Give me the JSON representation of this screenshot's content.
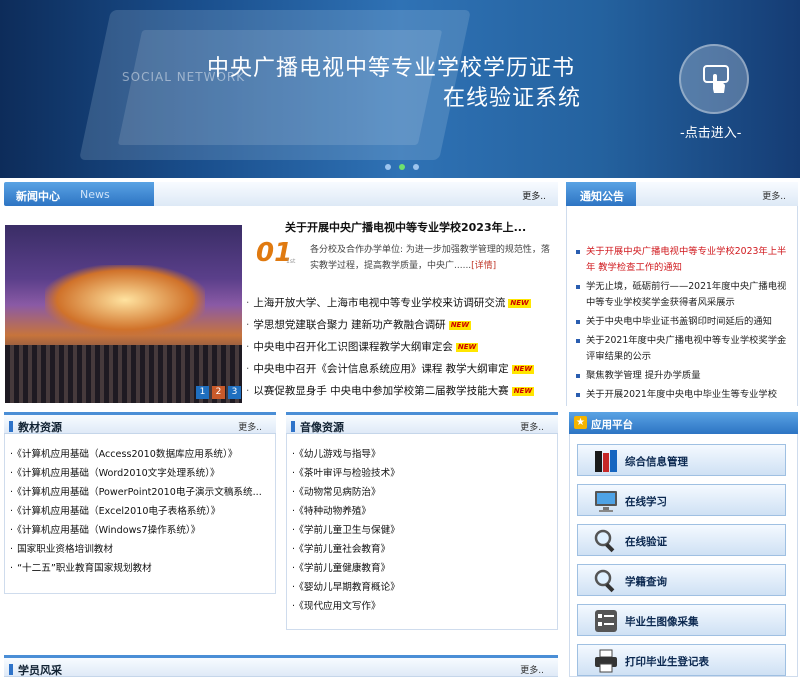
{
  "banner": {
    "title_line1": "中央广播电视中等专业学校学历证书",
    "title_line2": "在线验证系统",
    "watermark": "SOCIAL NETWORK",
    "enter_label": "-点击进入-",
    "slide_count": 3,
    "active_slide": 2
  },
  "news": {
    "label": "新闻中心",
    "sublabel": "News",
    "more": "更多..",
    "feature": {
      "title": "关于开展中央广播电视中等专业学校2023年上...",
      "date_num": "01",
      "date_sub": "1st",
      "desc": "各分校及合作办学单位: 为进一步加强教学管理的规范性，落实教学过程，提高教学质量，中央广......",
      "detail": "[详情]"
    },
    "photo_pages": [
      "1",
      "2",
      "3"
    ],
    "photo_active": "2",
    "new_badge": "NEW",
    "items": [
      "上海开放大学、上海市电视中等专业学校来访调研交流",
      "学思想党建联合聚力 建新功产教融合调研",
      "中央电中召开化工识图课程教学大纲审定会",
      "中央电中召开《会计信息系统应用》课程 教学大纲审定",
      "以赛促教显身手 中央电中参加学校第二届教学技能大赛"
    ]
  },
  "notice": {
    "label": "通知公告",
    "more": "更多..",
    "items": [
      {
        "text": "关于开展中央广播电视中等专业学校2023年上半年 教学检查工作的通知",
        "highlight": true
      },
      {
        "text": "学无止境，砥砺前行——2021年度中央广播电视中等专业学校奖学金获得者风采展示",
        "highlight": false
      },
      {
        "text": "关于中央电中毕业证书盖钢印时间延后的通知",
        "highlight": false
      },
      {
        "text": "关于2021年度中央广播电视中等专业学校奖学金评审结果的公示",
        "highlight": false
      },
      {
        "text": "聚焦教学管理 提升办学质量",
        "highlight": false
      },
      {
        "text": "关于开展2021年度中央电中毕业生等专业学校",
        "highlight": false
      }
    ]
  },
  "textbooks": {
    "label": "教材资源",
    "more": "更多..",
    "items": [
      "《计算机应用基础（Access2010数据库应用系统）》",
      "《计算机应用基础（Word2010文字处理系统）》",
      "《计算机应用基础（PowerPoint2010电子演示文稿系统...",
      "《计算机应用基础（Excel2010电子表格系统）》",
      "《计算机应用基础（Windows7操作系统）》",
      "国家职业资格培训教材",
      "“十二五”职业教育国家规划教材"
    ]
  },
  "media": {
    "label": "音像资源",
    "more": "更多..",
    "items": [
      "《幼儿游戏与指导》",
      "《茶叶审评与检验技术》",
      "《动物常见病防治》",
      "《特种动物养殖》",
      "《学前儿童卫生与保健》",
      "《学前儿童社会教育》",
      "《学前儿童健康教育》",
      "《婴幼儿早期教育概论》",
      "《现代应用文写作》"
    ]
  },
  "students": {
    "label": "学员风采",
    "more": "更多.."
  },
  "platform": {
    "label": "应用平台",
    "star": "★",
    "buttons": [
      {
        "label": "综合信息管理",
        "icon": "books-icon"
      },
      {
        "label": "在线学习",
        "icon": "monitor-icon"
      },
      {
        "label": "在线验证",
        "icon": "magnifier-icon"
      },
      {
        "label": "学籍查询",
        "icon": "magnifier-icon"
      },
      {
        "label": "毕业生图像采集",
        "icon": "checklist-icon"
      },
      {
        "label": "打印毕业生登记表",
        "icon": "printer-icon"
      }
    ]
  },
  "colors": {
    "accent": "#2d74c3",
    "highlight_text": "#d0191e",
    "new_badge_bg": "#ffe600"
  }
}
